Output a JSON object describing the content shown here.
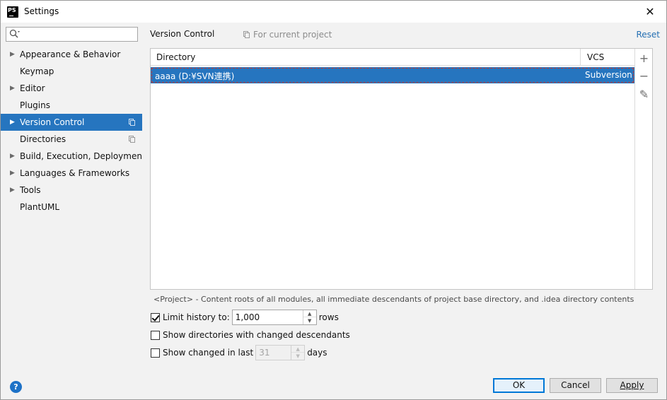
{
  "window": {
    "app_icon_text": "PS",
    "title": "Settings",
    "close_glyph": "✕"
  },
  "sidebar": {
    "search_placeholder": "",
    "items": [
      {
        "label": "Appearance & Behavior",
        "expandable": true,
        "project_scope": false,
        "selected": false
      },
      {
        "label": "Keymap",
        "expandable": false,
        "project_scope": false,
        "selected": false
      },
      {
        "label": "Editor",
        "expandable": true,
        "project_scope": false,
        "selected": false
      },
      {
        "label": "Plugins",
        "expandable": false,
        "project_scope": false,
        "selected": false
      },
      {
        "label": "Version Control",
        "expandable": true,
        "project_scope": true,
        "selected": true
      },
      {
        "label": "Directories",
        "expandable": false,
        "project_scope": true,
        "selected": false
      },
      {
        "label": "Build, Execution, Deployment",
        "expandable": true,
        "project_scope": false,
        "selected": false
      },
      {
        "label": "Languages & Frameworks",
        "expandable": true,
        "project_scope": false,
        "selected": false
      },
      {
        "label": "Tools",
        "expandable": true,
        "project_scope": false,
        "selected": false
      },
      {
        "label": "PlantUML",
        "expandable": false,
        "project_scope": false,
        "selected": false
      }
    ]
  },
  "main": {
    "title": "Version Control",
    "scope_label": "For current project",
    "reset_label": "Reset",
    "table": {
      "columns": [
        "Directory",
        "VCS"
      ],
      "rows": [
        {
          "directory": "aaaa (D:¥SVN連携)",
          "vcs": "Subversion",
          "selected": true
        }
      ]
    },
    "toolbar": {
      "add_glyph": "+",
      "remove_glyph": "−",
      "edit_glyph": "✎"
    },
    "note": "<Project> - Content roots of all modules, all immediate descendants of project base directory, and .idea directory contents",
    "options": {
      "limit_history": {
        "label": "Limit history to:",
        "checked": true,
        "value": "1,000",
        "suffix": "rows"
      },
      "show_dirs": {
        "label": "Show directories with changed descendants",
        "checked": false
      },
      "show_changed": {
        "label": "Show changed in last",
        "checked": false,
        "value": "31",
        "suffix": "days"
      }
    }
  },
  "footer": {
    "help_glyph": "?",
    "ok_label": "OK",
    "cancel_label": "Cancel",
    "apply_label": "Apply"
  },
  "colors": {
    "selection": "#2675bf",
    "link": "#2470b3",
    "focus_dash": "#c8372d"
  }
}
